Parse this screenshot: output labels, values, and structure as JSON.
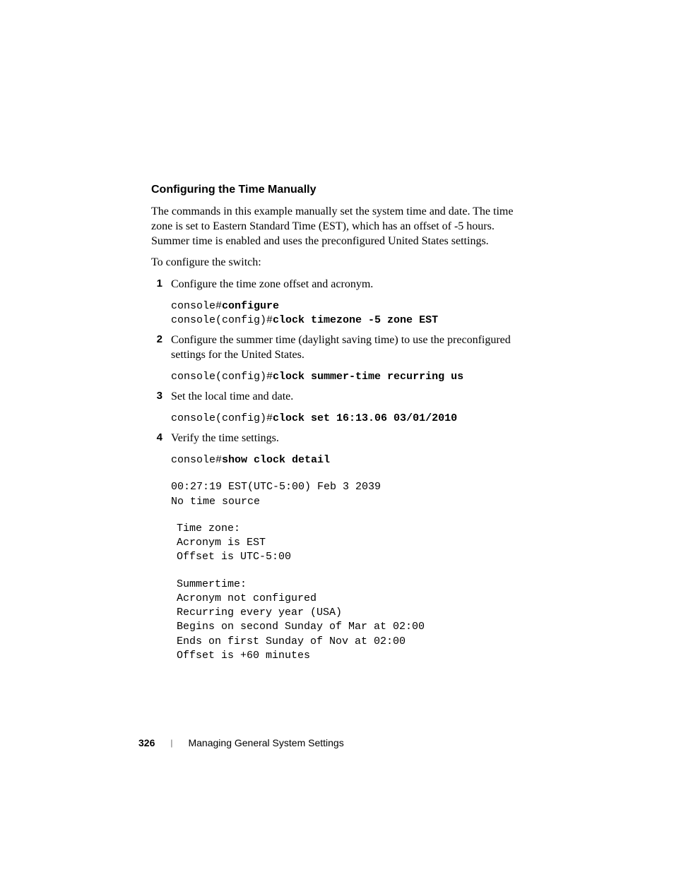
{
  "heading": "Configuring the Time Manually",
  "intro": "The commands in this example manually set the system time and date. The time zone is set to Eastern Standard Time (EST), which has an offset of -5 hours. Summer time is enabled and uses the preconfigured United States settings.",
  "config_line": "To configure the switch:",
  "steps": [
    {
      "num": "1",
      "text": "Configure the time zone offset and acronym.",
      "code": [
        {
          "prefix": "console#",
          "bold": "configure"
        },
        {
          "prefix": "console(config)#",
          "bold": "clock timezone -5 zone EST"
        }
      ]
    },
    {
      "num": "2",
      "text": "Configure the summer time (daylight saving time) to use the preconfigured settings for the United States.",
      "code": [
        {
          "prefix": "console(config)#",
          "bold": "clock summer-time recurring us"
        }
      ]
    },
    {
      "num": "3",
      "text": "Set the local time and date.",
      "code": [
        {
          "prefix": "console(config)#",
          "bold": "clock set 16:13.06 03/01/2010"
        }
      ]
    },
    {
      "num": "4",
      "text": "Verify the time settings.",
      "code": [
        {
          "prefix": "console#",
          "bold": "show clock detail"
        }
      ]
    }
  ],
  "output1": "00:27:19 EST(UTC-5:00) Feb 3 2039\nNo time source",
  "output2": "Time zone:\nAcronym is EST\nOffset is UTC-5:00",
  "output3": "Summertime:\nAcronym not configured\nRecurring every year (USA)\nBegins on second Sunday of Mar at 02:00\nEnds on first Sunday of Nov at 02:00\nOffset is +60 minutes",
  "footer": {
    "page": "326",
    "title": "Managing General System Settings"
  }
}
